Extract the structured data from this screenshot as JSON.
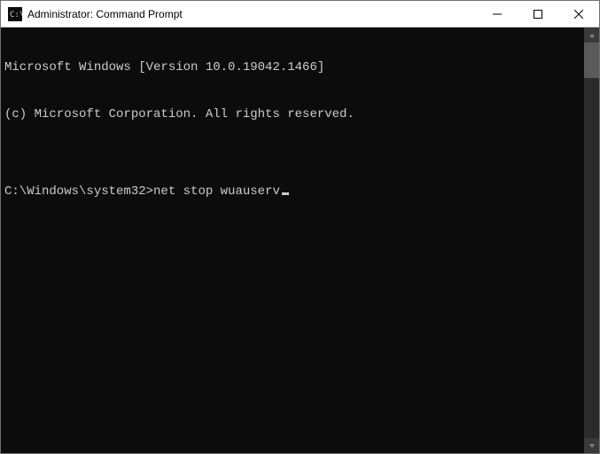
{
  "window": {
    "title": "Administrator: Command Prompt"
  },
  "terminal": {
    "line1": "Microsoft Windows [Version 10.0.19042.1466]",
    "line2": "(c) Microsoft Corporation. All rights reserved.",
    "blank": "",
    "prompt": "C:\\Windows\\system32>",
    "command": "net stop wuauserv"
  }
}
